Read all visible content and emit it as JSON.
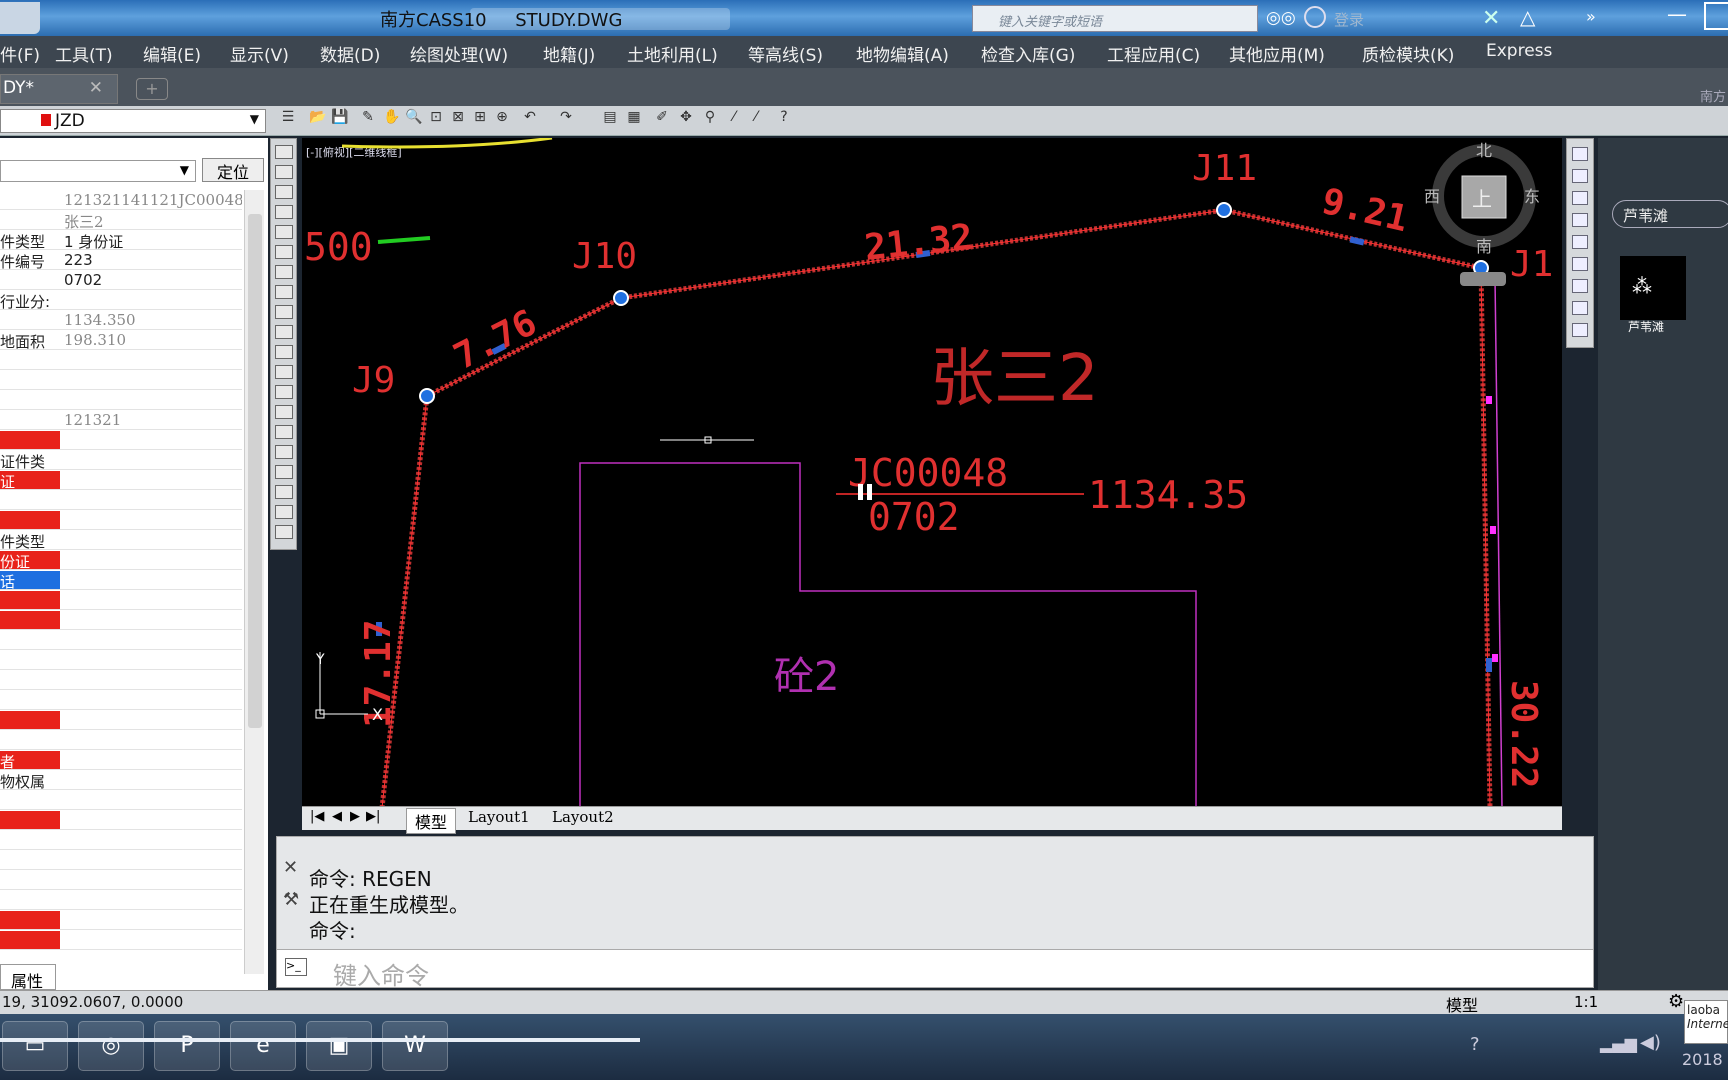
{
  "window": {
    "title": "南方CASS10     STUDY.DWG",
    "search_placeholder": "键入关键字或短语",
    "login": "登录"
  },
  "menu": [
    "件(F)",
    "工具(T)",
    "编辑(E)",
    "显示(V)",
    "数据(D)",
    "绘图处理(W)",
    "地籍(J)",
    "土地利用(L)",
    "等高线(S)",
    "地物编辑(A)",
    "检查入库(G)",
    "工程应用(C)",
    "其他应用(M)",
    "质检模块(K)",
    "Express"
  ],
  "doc_tab": {
    "label": "DY*"
  },
  "top_right_label": "南方",
  "layer": {
    "name": "JZD"
  },
  "left_panel": {
    "locate_button": "定位",
    "bottom_tab": "属性",
    "rows": [
      [
        "",
        "121321141121JC00048",
        false
      ],
      [
        "",
        "张三2",
        false
      ],
      [
        "件类型",
        "1 身份证",
        false
      ],
      [
        "件编号",
        "223",
        false
      ],
      [
        "",
        "0702",
        false
      ],
      [
        "行业分:",
        "",
        false
      ],
      [
        "",
        "1134.350",
        false
      ],
      [
        "地面积",
        "198.310",
        false
      ],
      [
        "",
        "",
        false
      ],
      [
        "",
        "",
        false
      ],
      [
        "",
        "",
        false
      ],
      [
        "",
        "121321",
        false
      ],
      [
        "",
        "",
        true
      ],
      [
        "证件类",
        "",
        false
      ],
      [
        "证",
        "",
        true
      ],
      [
        "",
        "",
        false
      ],
      [
        "",
        "",
        true
      ],
      [
        "件类型",
        "",
        false
      ],
      [
        "份证",
        "",
        true
      ],
      [
        "话",
        "",
        "blue"
      ],
      [
        "",
        "",
        true
      ],
      [
        "",
        "",
        true
      ],
      [
        "",
        "",
        false
      ],
      [
        "",
        "",
        false
      ],
      [
        "",
        "",
        false
      ],
      [
        "",
        "",
        false
      ],
      [
        "",
        "",
        true
      ],
      [
        "",
        "",
        false
      ],
      [
        "者",
        "",
        true
      ],
      [
        "物权属",
        "",
        false
      ],
      [
        "",
        "",
        false
      ],
      [
        "",
        "",
        true
      ],
      [
        "",
        "",
        false
      ],
      [
        "",
        "",
        false
      ],
      [
        "",
        "",
        false
      ],
      [
        "",
        "",
        false
      ],
      [
        "",
        "",
        true
      ],
      [
        "",
        "",
        true
      ]
    ]
  },
  "drawing": {
    "viewport_label": "[-][俯视][二维线框]",
    "scale_label": "500",
    "parcel_owner": "张三2",
    "parcel_code": "JC00048",
    "parcel_class": "0702",
    "parcel_area": "1134.35",
    "building_label": "砼2",
    "compass": {
      "north": "北",
      "south": "南",
      "east": "东",
      "west": "西",
      "top": "上"
    },
    "points": [
      {
        "label": "J9"
      },
      {
        "label": "J10"
      },
      {
        "label": "J11"
      },
      {
        "label": "J1"
      }
    ],
    "edges": [
      "7.76",
      "21.32",
      "9.21",
      "17.17",
      "30.22"
    ],
    "ucs": {
      "x": "X",
      "y": "Y"
    }
  },
  "layout_tabs": [
    "模型",
    "Layout1",
    "Layout2"
  ],
  "command": {
    "lines": [
      "命令: REGEN",
      "正在重生成模型。",
      "命令:"
    ],
    "placeholder": "键入命令"
  },
  "right_panel": {
    "search_value": "芦苇滩",
    "thumbnail_label": "芦苇滩"
  },
  "status": {
    "coords": "19, 31092.0607, 0.0000",
    "model": "模型",
    "scale": "1:1"
  },
  "tray": {
    "label1": "laoba",
    "label2": "Interne",
    "year": "2018"
  }
}
